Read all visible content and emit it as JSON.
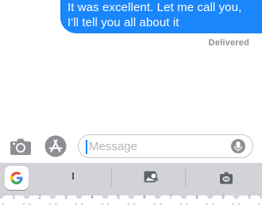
{
  "conversation": {
    "message_lines": [
      "It was excellent. Let me call you,",
      "I'll tell you all about it"
    ],
    "status": "Delivered"
  },
  "input_bar": {
    "placeholder": "Message",
    "icons": {
      "camera": "camera-icon",
      "apps": "app-store-icon",
      "mic": "microphone-icon"
    }
  },
  "keyboard": {
    "suggestion": "I",
    "icons": {
      "google": "google-logo-icon",
      "image_search": "image-search-icon",
      "gif": "gif-icon"
    },
    "number_hints": [
      "1",
      "2",
      "3",
      "4",
      "5",
      "6",
      "7",
      "8",
      "9",
      "0"
    ]
  },
  "colors": {
    "bubble_blue": "#1a86fb",
    "keyboard_bg": "#d1d3d9",
    "icon_gray": "#8e8e93"
  }
}
